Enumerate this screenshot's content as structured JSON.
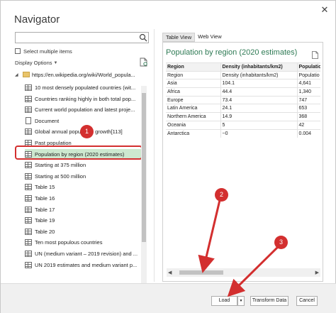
{
  "window": {
    "title": "Navigator",
    "close_glyph": "✕"
  },
  "left": {
    "search": {
      "value": "",
      "placeholder": ""
    },
    "select_multiple_label": "Select multiple items",
    "display_options_label": "Display Options",
    "root_url": "https://en.wikipedia.org/wiki/World_popula...",
    "items": [
      {
        "label": "10 most densely populated countries (wit...",
        "icon": "table-icon"
      },
      {
        "label": "Countries ranking highly in both total pop...",
        "icon": "table-icon"
      },
      {
        "label": "Current world population and latest proje...",
        "icon": "table-icon"
      },
      {
        "label": "Document",
        "icon": "document-icon"
      },
      {
        "label": "Global annual population growth[113]",
        "icon": "table-icon"
      },
      {
        "label": "Past population",
        "icon": "table-icon"
      },
      {
        "label": "Population by region (2020 estimates)",
        "icon": "table-icon",
        "selected": true
      },
      {
        "label": "Starting at 375 million",
        "icon": "table-icon"
      },
      {
        "label": "Starting at 500 million",
        "icon": "table-icon"
      },
      {
        "label": "Table 15",
        "icon": "table-icon"
      },
      {
        "label": "Table 16",
        "icon": "table-icon"
      },
      {
        "label": "Table 17",
        "icon": "table-icon"
      },
      {
        "label": "Table 19",
        "icon": "table-icon"
      },
      {
        "label": "Table 20",
        "icon": "table-icon"
      },
      {
        "label": "Ten most populous countries",
        "icon": "table-icon"
      },
      {
        "label": "UN (medium variant – 2019 revision) and ...",
        "icon": "table-icon"
      },
      {
        "label": "UN 2019 estimates and medium variant p...",
        "icon": "table-icon"
      }
    ]
  },
  "right": {
    "tabs": [
      {
        "label": "Table View",
        "active": true
      },
      {
        "label": "Web View",
        "active": false
      }
    ],
    "preview_title": "Population by region (2020 estimates)",
    "table": {
      "columns": [
        "Region",
        "Density (inhabitants/km2)",
        "Population"
      ],
      "rows": [
        [
          "Region",
          "Density (inhabitants/km2)",
          "Populatio"
        ],
        [
          "Asia",
          "104.1",
          "4,641"
        ],
        [
          "Africa",
          "44.4",
          "1,340"
        ],
        [
          "Europe",
          "73.4",
          "747"
        ],
        [
          "Latin America",
          "24.1",
          "653"
        ],
        [
          "Northern America",
          "14.9",
          "368"
        ],
        [
          "Oceania",
          "5",
          "42"
        ],
        [
          "Antarctica",
          "~0",
          "0.004"
        ]
      ]
    }
  },
  "footer": {
    "load_label": "Load",
    "load_dropdown_glyph": "▼",
    "transform_label": "Transform Data",
    "cancel_label": "Cancel"
  },
  "annotations": {
    "badges": [
      "1",
      "2",
      "3"
    ],
    "color": "#d32f2f"
  },
  "colors": {
    "accent_title": "#2e7a54",
    "selected_row": "#cde8cf"
  }
}
